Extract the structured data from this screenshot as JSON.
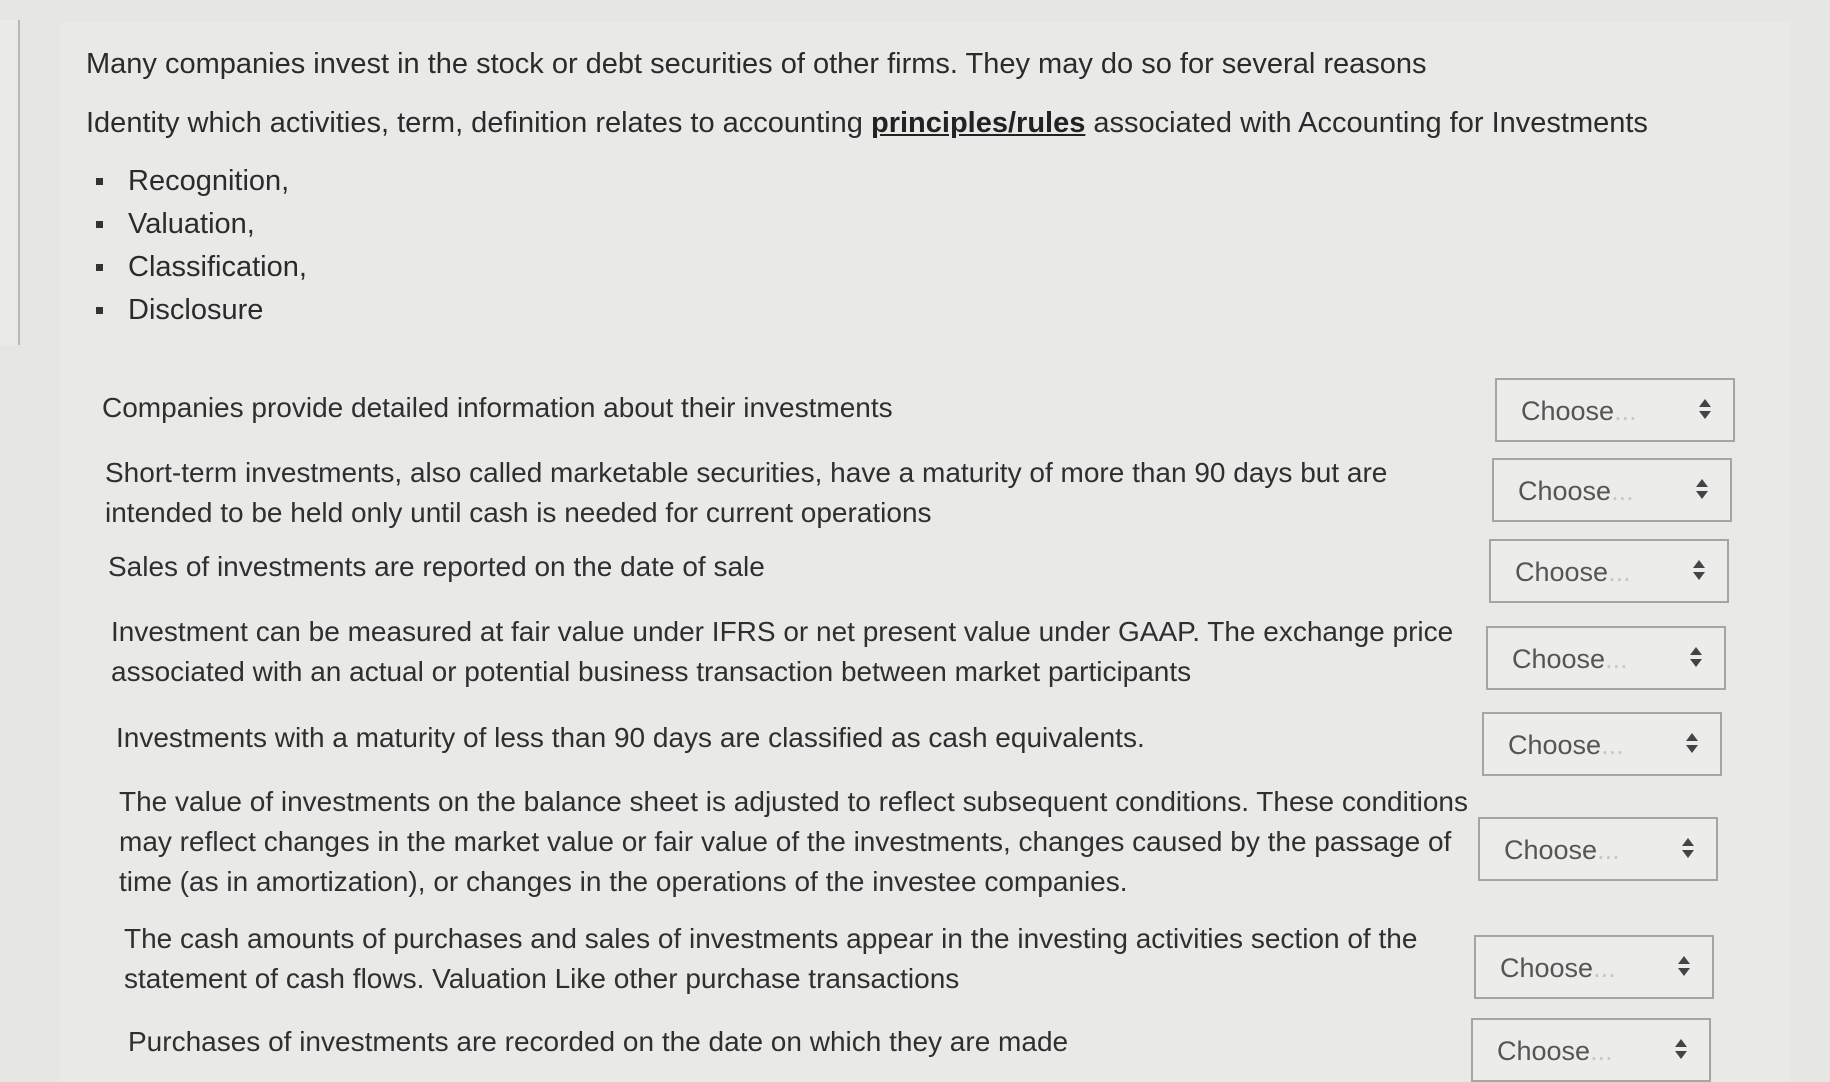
{
  "intro": {
    "line1": "Many companies invest in the stock or debt securities of other firms. They may do so for several reasons",
    "line2_before": "Identity which activities, term, definition relates to accounting ",
    "line2_link": "principles/rules",
    "line2_after": " associated with Accounting for Investments"
  },
  "categories": [
    "Recognition,",
    "Valuation,",
    "Classification,",
    "Disclosure"
  ],
  "questions": [
    {
      "text": "Companies provide detailed information about their investments",
      "select": "Choose"
    },
    {
      "text": "Short-term investments, also called marketable securities, have a maturity of more than 90 days but are intended to be held only until cash is needed for current operations",
      "select": "Choose"
    },
    {
      "text": "Sales of investments are reported on the date of sale",
      "select": "Choose"
    },
    {
      "text": "Investment can be measured at fair value under IFRS or net present value under GAAP. The exchange price associated with an actual or potential business transaction between market participants",
      "select": "Choose"
    },
    {
      "text": "Investments with a maturity of less than 90 days are classified as cash equivalents.",
      "select": "Choose"
    },
    {
      "text": "The value of investments on the balance sheet is adjusted to reflect subsequent conditions. These conditions may reflect changes in the market value or fair value of the investments, changes caused by the passage of time (as in amortization), or changes in the operations of the investee companies.",
      "select": "Choose"
    },
    {
      "text": "The cash amounts of purchases and sales of investments appear in the investing activities section of the statement of cash flows. Valuation Like other purchase transactions",
      "select": "Choose"
    },
    {
      "text": "Purchases of investments are recorded on the date on which they are made",
      "select": "Choose"
    }
  ]
}
